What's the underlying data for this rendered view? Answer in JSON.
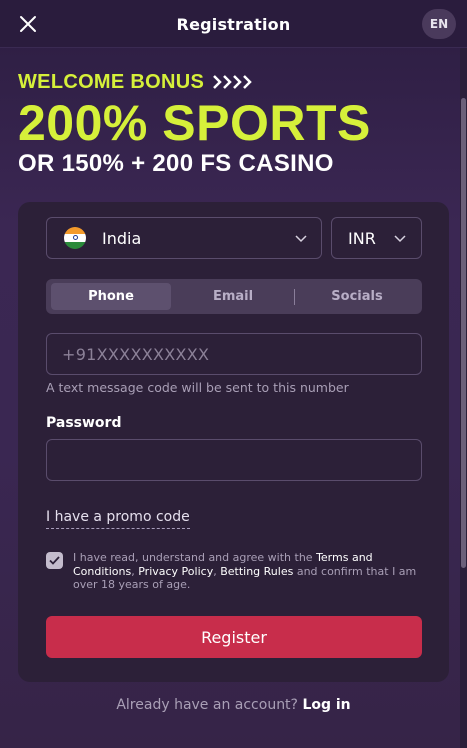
{
  "header": {
    "title": "Registration",
    "close_icon": "close-icon",
    "language": "EN"
  },
  "banner": {
    "welcome": "WELCOME BONUS",
    "arrows_icon": "chevrons-right-icon",
    "headline": "200% SPORTS",
    "subline": "OR 150% + 200 FS CASINO",
    "accent_color": "#d6f03a"
  },
  "form": {
    "country": {
      "flag_icon": "india-flag-icon",
      "value": "India"
    },
    "currency": {
      "value": "INR"
    },
    "tabs": [
      {
        "label": "Phone",
        "active": true
      },
      {
        "label": "Email",
        "active": false
      },
      {
        "label": "Socials",
        "active": false
      }
    ],
    "phone": {
      "placeholder": "+91XXXXXXXXXX",
      "hint": "A text message code will be sent to this number"
    },
    "password": {
      "label": "Password",
      "value": ""
    },
    "promo_link": "I have a promo code",
    "terms": {
      "checked": true,
      "text_1": "I have read, understand and agree with the ",
      "link_terms": "Terms and Conditions",
      "sep_1": ", ",
      "link_privacy": "Privacy Policy",
      "sep_2": ", ",
      "link_betting": "Betting Rules",
      "text_2": " and confirm that I am over 18 years of age."
    },
    "register_label": "Register",
    "register_color": "#c82d4b"
  },
  "footer": {
    "prompt": "Already have an account?",
    "login_label": "Log in"
  }
}
